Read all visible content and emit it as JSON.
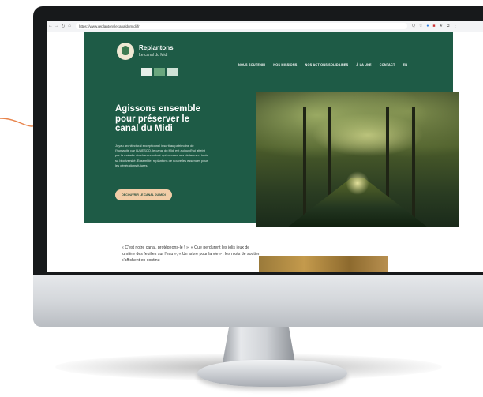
{
  "browser": {
    "url": "https://www.replantonslecanaldumidi.fr",
    "nav_back": "←",
    "nav_forward": "→",
    "nav_reload": "↻",
    "nav_home": "⌂",
    "extension_icons": [
      "Q",
      "☆",
      "●",
      "■",
      "★",
      "⧉",
      "⋮"
    ]
  },
  "site": {
    "brand_title": "Replantons",
    "brand_subtitle": "Le canal du Midi",
    "nav": [
      "NOUS SOUTENIR",
      "NOS MISSIONS",
      "NOS ACTIONS SOLIDAIRES",
      "À LA UNE",
      "CONTACT",
      "EN"
    ],
    "hero_title": "Agissons ensemble pour préserver le canal du Midi",
    "hero_body": "Joyau architectural exceptionnel inscrit au patrimoine de l'humanité par l'UNESCO, le canal du Midi est aujourd'hui atteint par la maladie du chancre coloré qui menace ses platanes et toute sa biodiversité. Ensemble, replantons de nouvelles essences pour les générations futures.",
    "cta_label": "DÉCOUVRIR LE CANAL DU MIDI",
    "quote": "« C'est notre canal, protégeons-le ! », « Que perdurent les jolis jeux de lumière des feuilles sur l'eau », « Un arbre pour la vie » : les mots de soutien s'affichent en continu"
  },
  "colors": {
    "hero_green": "#1e5b46",
    "cta_peach": "#f2cda7",
    "accent_orange": "#e8834a"
  }
}
